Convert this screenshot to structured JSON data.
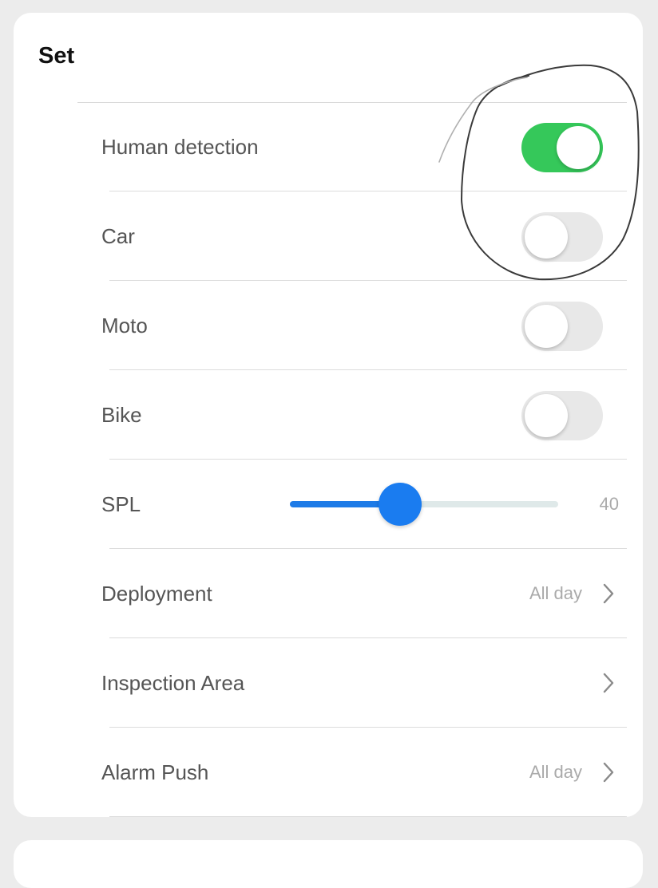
{
  "section": {
    "title": "Set"
  },
  "rows": [
    {
      "label": "Human detection",
      "type": "toggle",
      "on": true
    },
    {
      "label": "Car",
      "type": "toggle",
      "on": false
    },
    {
      "label": "Moto",
      "type": "toggle",
      "on": false
    },
    {
      "label": "Bike",
      "type": "toggle",
      "on": false
    },
    {
      "label": "SPL",
      "type": "slider",
      "value": "40",
      "fraction": 0.41
    },
    {
      "label": "Deployment",
      "type": "nav",
      "value": "All day"
    },
    {
      "label": "Inspection Area",
      "type": "nav",
      "value": ""
    },
    {
      "label": "Alarm Push",
      "type": "nav",
      "value": "All day"
    }
  ],
  "colors": {
    "toggle_on": "#35c85a",
    "toggle_off": "#e8e8e8",
    "slider_accent": "#1a7cf0",
    "annotation_stroke": "#3a3a3a"
  },
  "icons": {
    "chevron": "chevron-right-icon"
  }
}
